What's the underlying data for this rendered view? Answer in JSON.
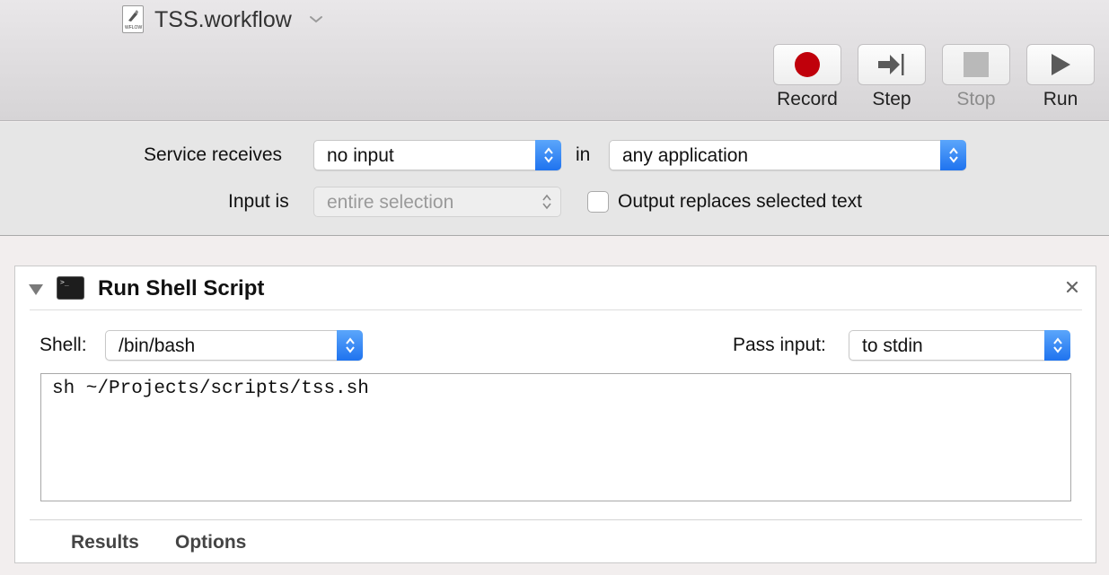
{
  "window": {
    "title": "TSS.workflow",
    "doc_icon_text": "WFLOW"
  },
  "toolbar": {
    "record_label": "Record",
    "step_label": "Step",
    "stop_label": "Stop",
    "run_label": "Run",
    "record_color": "#c0000b"
  },
  "service": {
    "receives_label": "Service receives",
    "receives_value": "no input",
    "in_label": "in",
    "application_value": "any application",
    "input_is_label": "Input is",
    "input_is_value": "entire selection",
    "output_replaces_label": "Output replaces selected text",
    "output_replaces_checked": false
  },
  "action": {
    "title": "Run Shell Script",
    "shell_label": "Shell:",
    "shell_value": "/bin/bash",
    "pass_input_label": "Pass input:",
    "pass_input_value": "to stdin",
    "script": "sh ~/Projects/scripts/tss.sh",
    "tabs": [
      "Results",
      "Options"
    ]
  },
  "colors": {
    "accent": "#2a7ff2"
  }
}
